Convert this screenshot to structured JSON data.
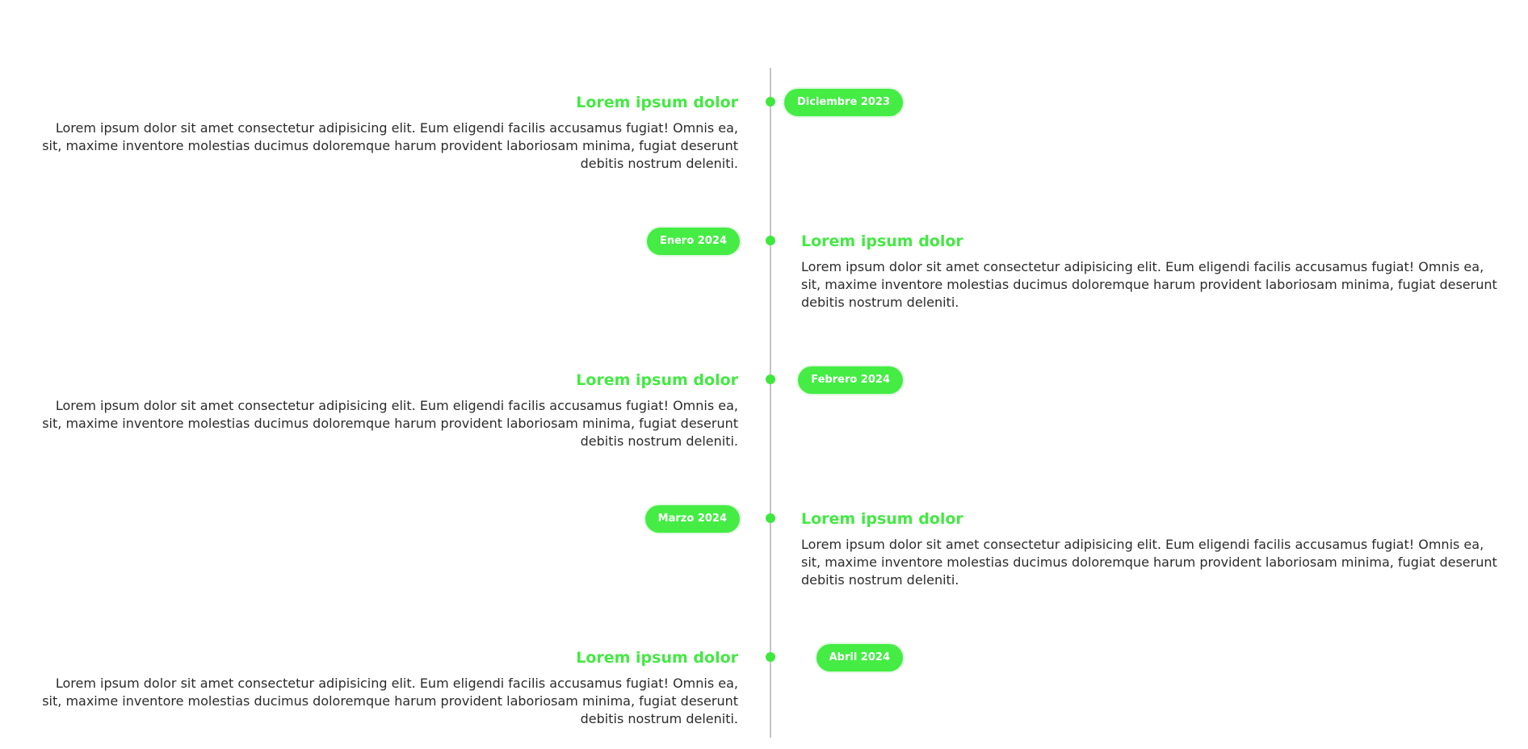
{
  "timeline": {
    "accent_color": "#44ec44",
    "line_color": "#c4c4c4",
    "events": [
      {
        "title": "Lorem ipsum dolor",
        "description": "Lorem ipsum dolor sit amet consectetur adipisicing elit. Eum eligendi facilis accusamus fugiat! Omnis ea, sit, maxime inventore molestias ducimus doloremque harum provident laboriosam minima, fugiat deserunt debitis nostrum deleniti.",
        "date": "Diciembre 2023"
      },
      {
        "title": "Lorem ipsum dolor",
        "description": "Lorem ipsum dolor sit amet consectetur adipisicing elit. Eum eligendi facilis accusamus fugiat! Omnis ea, sit, maxime inventore molestias ducimus doloremque harum provident laboriosam minima, fugiat deserunt debitis nostrum deleniti.",
        "date": "Enero 2024"
      },
      {
        "title": "Lorem ipsum dolor",
        "description": "Lorem ipsum dolor sit amet consectetur adipisicing elit. Eum eligendi facilis accusamus fugiat! Omnis ea, sit, maxime inventore molestias ducimus doloremque harum provident laboriosam minima, fugiat deserunt debitis nostrum deleniti.",
        "date": "Febrero 2024"
      },
      {
        "title": "Lorem ipsum dolor",
        "description": "Lorem ipsum dolor sit amet consectetur adipisicing elit. Eum eligendi facilis accusamus fugiat! Omnis ea, sit, maxime inventore molestias ducimus doloremque harum provident laboriosam minima, fugiat deserunt debitis nostrum deleniti.",
        "date": "Marzo 2024"
      },
      {
        "title": "Lorem ipsum dolor",
        "description": "Lorem ipsum dolor sit amet consectetur adipisicing elit. Eum eligendi facilis accusamus fugiat! Omnis ea, sit, maxime inventore molestias ducimus doloremque harum provident laboriosam minima, fugiat deserunt debitis nostrum deleniti.",
        "date": "Abril 2024"
      }
    ]
  }
}
